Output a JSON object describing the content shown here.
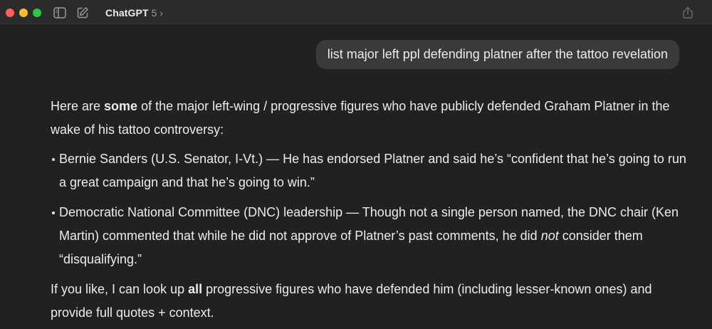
{
  "titlebar": {
    "model_name": "ChatGPT",
    "model_version": "5",
    "model_chevron": "›"
  },
  "user_message": "list major left ppl defending platner after the tattoo revelation",
  "answer": {
    "intro": {
      "pre": "Here are ",
      "bold": "some",
      "post": " of the major left-wing / progressive figures who have publicly defended Graham Platner in the wake of his tattoo controversy:"
    },
    "bullets": [
      {
        "text": "Bernie Sanders (U.S. Senator, I-Vt.) — He has endorsed Platner and said he’s “confident that he’s going to run a great campaign and that he’s going to win.”"
      },
      {
        "pre": "Democratic National Committee (DNC) leadership — Though not a single person named, the DNC chair (Ken Martin) commented that while he did not approve of Platner’s past comments, he did ",
        "italic": "not",
        "post": " consider them “disqualifying.”"
      }
    ],
    "followup": {
      "pre": "If you like, I can look up ",
      "bold": "all",
      "post": " progressive figures who have defended him (including lesser-known ones) and provide full quotes + context."
    }
  },
  "colors": {
    "background": "#212121",
    "titlebar": "#2b2b2b",
    "user_bubble": "#3a3a3a",
    "text": "#ececec"
  },
  "icons": [
    "sidebar-toggle-icon",
    "new-chat-icon",
    "share-icon"
  ]
}
